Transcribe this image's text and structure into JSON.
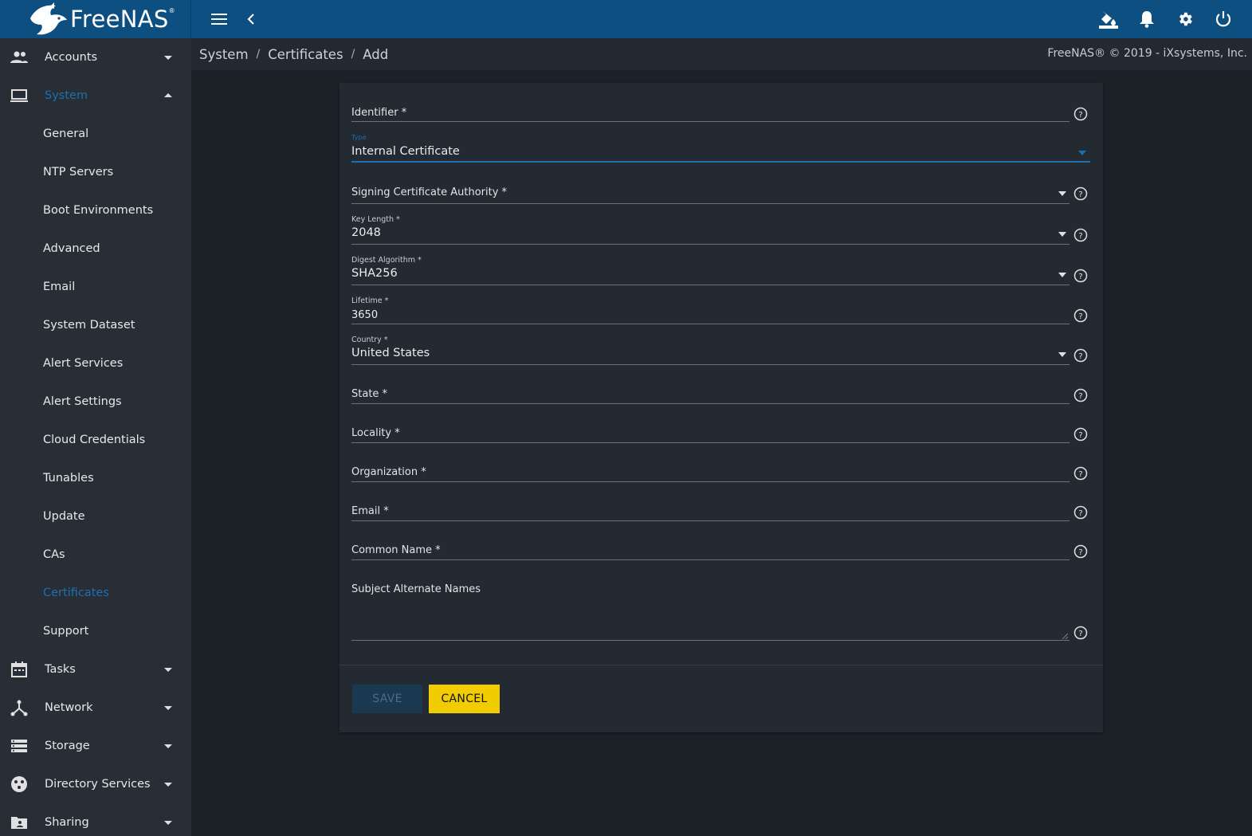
{
  "app": {
    "logo_text": "FreeNAS",
    "logo_mark": "®",
    "colors": {
      "header": "#0d4f80",
      "sidebar": "#282e36",
      "card": "#232a32",
      "accent": "#1e6fb0",
      "cancel": "#f0cc00"
    }
  },
  "topbar": {
    "icons": [
      "menu-icon",
      "chevron-left-icon",
      "theme-paint-icon",
      "bell-icon",
      "gear-icon",
      "power-icon"
    ]
  },
  "sidebar": {
    "items": [
      {
        "label": "Accounts",
        "icon": "accounts-icon",
        "expanded": false
      },
      {
        "label": "System",
        "icon": "laptop-icon",
        "expanded": true,
        "active": true
      },
      {
        "label": "Tasks",
        "icon": "calendar-icon",
        "expanded": false
      },
      {
        "label": "Network",
        "icon": "network-icon",
        "expanded": false
      },
      {
        "label": "Storage",
        "icon": "storage-icon",
        "expanded": false
      },
      {
        "label": "Directory Services",
        "icon": "directory-services-icon",
        "expanded": false
      },
      {
        "label": "Sharing",
        "icon": "sharing-folder-icon",
        "expanded": false
      }
    ],
    "system_children": [
      "General",
      "NTP Servers",
      "Boot Environments",
      "Advanced",
      "Email",
      "System Dataset",
      "Alert Services",
      "Alert Settings",
      "Cloud Credentials",
      "Tunables",
      "Update",
      "CAs",
      "Certificates",
      "Support"
    ],
    "active_child": "Certificates"
  },
  "breadcrumb": {
    "items": [
      "System",
      "Certificates",
      "Add"
    ],
    "separator": "/",
    "copyright": "FreeNAS® © 2019 - iXsystems, Inc."
  },
  "form": {
    "identifier": {
      "label": "Identifier *",
      "value": ""
    },
    "type": {
      "label": "Type",
      "value": "Internal Certificate"
    },
    "signing_ca": {
      "label": "Signing Certificate Authority *",
      "value": ""
    },
    "key_length": {
      "label": "Key Length *",
      "value": "2048"
    },
    "digest": {
      "label": "Digest Algorithm *",
      "value": "SHA256"
    },
    "lifetime": {
      "label": "Lifetime *",
      "value": "3650"
    },
    "country": {
      "label": "Country *",
      "value": "United States"
    },
    "state": {
      "label": "State *",
      "value": ""
    },
    "locality": {
      "label": "Locality *",
      "value": ""
    },
    "organization": {
      "label": "Organization *",
      "value": ""
    },
    "email": {
      "label": "Email *",
      "value": ""
    },
    "common_name": {
      "label": "Common Name *",
      "value": ""
    },
    "san": {
      "label": "Subject Alternate Names",
      "value": ""
    },
    "save_label": "SAVE",
    "cancel_label": "CANCEL"
  }
}
